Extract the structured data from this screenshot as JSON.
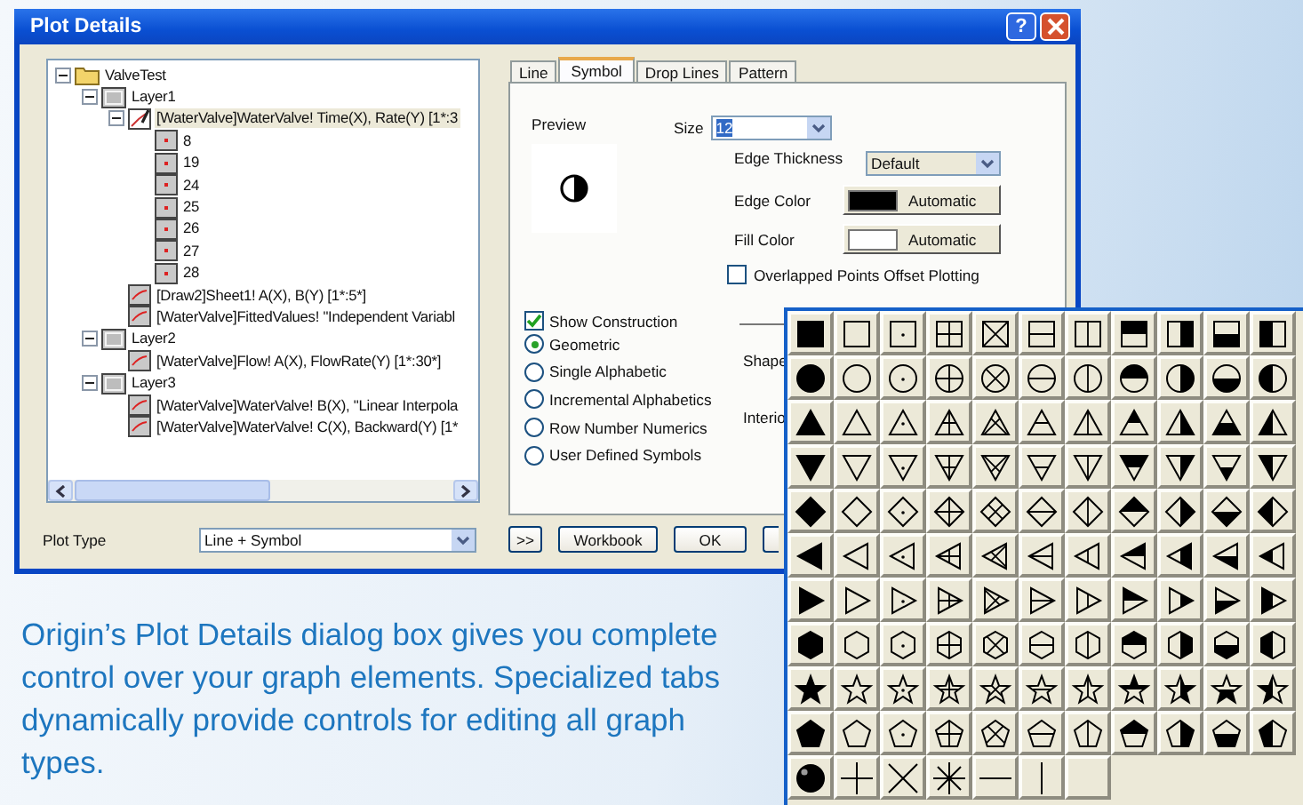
{
  "window": {
    "title": "Plot Details",
    "help_button": "?"
  },
  "tree": [
    {
      "label": "ValveTest",
      "kind": "folder",
      "expanded": true,
      "selected": false,
      "children": [
        {
          "label": "Layer1",
          "kind": "layer",
          "expanded": true,
          "selected": false,
          "children": [
            {
              "label": "[WaterValve]WaterValve! Time(X), Rate(Y) [1*:3",
              "kind": "plot",
              "expanded": true,
              "selected": true,
              "children": [
                {
                  "label": "8",
                  "kind": "point",
                  "selected": false
                },
                {
                  "label": "19",
                  "kind": "point",
                  "selected": false
                },
                {
                  "label": "24",
                  "kind": "point",
                  "selected": false
                },
                {
                  "label": "25",
                  "kind": "point",
                  "selected": false
                },
                {
                  "label": "26",
                  "kind": "point",
                  "selected": false
                },
                {
                  "label": "27",
                  "kind": "point",
                  "selected": false
                },
                {
                  "label": "28",
                  "kind": "point",
                  "selected": false
                }
              ]
            },
            {
              "label": "[Draw2]Sheet1! A(X), B(Y) [1*:5*]",
              "kind": "curve",
              "selected": false
            },
            {
              "label": "[WaterValve]FittedValues! \"Independent Variabl",
              "kind": "curve",
              "selected": false
            }
          ]
        },
        {
          "label": "Layer2",
          "kind": "layer",
          "expanded": true,
          "selected": false,
          "children": [
            {
              "label": "[WaterValve]Flow! A(X), FlowRate(Y) [1*:30*]",
              "kind": "curve",
              "selected": false
            }
          ]
        },
        {
          "label": "Layer3",
          "kind": "layer",
          "expanded": true,
          "selected": false,
          "children": [
            {
              "label": "[WaterValve]WaterValve! B(X), \"Linear Interpola",
              "kind": "curve",
              "selected": false
            },
            {
              "label": "[WaterValve]WaterValve! C(X), Backward(Y) [1*",
              "kind": "curve",
              "selected": false
            }
          ]
        }
      ]
    }
  ],
  "tabs": [
    {
      "label": "Line",
      "selected": false
    },
    {
      "label": "Symbol",
      "selected": true
    },
    {
      "label": "Drop Lines",
      "selected": false
    },
    {
      "label": "Pattern",
      "selected": false
    }
  ],
  "symbol_tab": {
    "preview_label": "Preview",
    "size": {
      "label": "Size",
      "value": "12"
    },
    "edge_thickness": {
      "label": "Edge Thickness",
      "value": "Default"
    },
    "colors": [
      {
        "label": "Edge Color",
        "button": "Automatic",
        "color": "#000000"
      },
      {
        "label": "Fill Color",
        "button": "Automatic",
        "color": "#ffffff"
      }
    ],
    "offset_plotting": {
      "label": "Overlapped Points Offset Plotting",
      "checked": false
    },
    "show_construction": {
      "label": "Show Construction",
      "checked": true
    },
    "construction_types": [
      {
        "label": "Geometric",
        "selected": true
      },
      {
        "label": "Single Alphabetic",
        "selected": false
      },
      {
        "label": "Incremental Alphabetics",
        "selected": false
      },
      {
        "label": "Row Number Numerics",
        "selected": false
      },
      {
        "label": "User Defined Symbols",
        "selected": false
      }
    ],
    "shape_label": "Shape",
    "interior_label": "Interio"
  },
  "bottom": {
    "plot_type": {
      "label": "Plot Type",
      "value": "Line + Symbol"
    },
    "buttons": [
      ">>",
      "Workbook",
      "OK"
    ]
  },
  "symbol_palette": {
    "columns": [
      {
        "kind": "solid"
      },
      {
        "kind": "open"
      },
      {
        "kind": "dot"
      },
      {
        "kind": "plus"
      },
      {
        "kind": "cross"
      },
      {
        "kind": "hline"
      },
      {
        "kind": "vline"
      },
      {
        "kind": "top"
      },
      {
        "kind": "right"
      },
      {
        "kind": "bottom"
      },
      {
        "kind": "left"
      }
    ],
    "rows": [
      {
        "kind": "square"
      },
      {
        "kind": "circle"
      },
      {
        "kind": "up"
      },
      {
        "kind": "down"
      },
      {
        "kind": "diamond"
      },
      {
        "kind": "left"
      },
      {
        "kind": "right"
      },
      {
        "kind": "hexagon"
      },
      {
        "kind": "star"
      },
      {
        "kind": "pentagon"
      }
    ],
    "extras": [
      {
        "kind": "ball"
      },
      {
        "kind": "plus"
      },
      {
        "kind": "x"
      },
      {
        "kind": "asterisk"
      },
      {
        "kind": "hline"
      },
      {
        "kind": "vline"
      },
      {
        "kind": "blank"
      }
    ]
  },
  "caption": "Origin’s Plot Details dialog box gives you complete control over your graph elements. Specialized tabs dynamically provide controls for editing all graph types."
}
